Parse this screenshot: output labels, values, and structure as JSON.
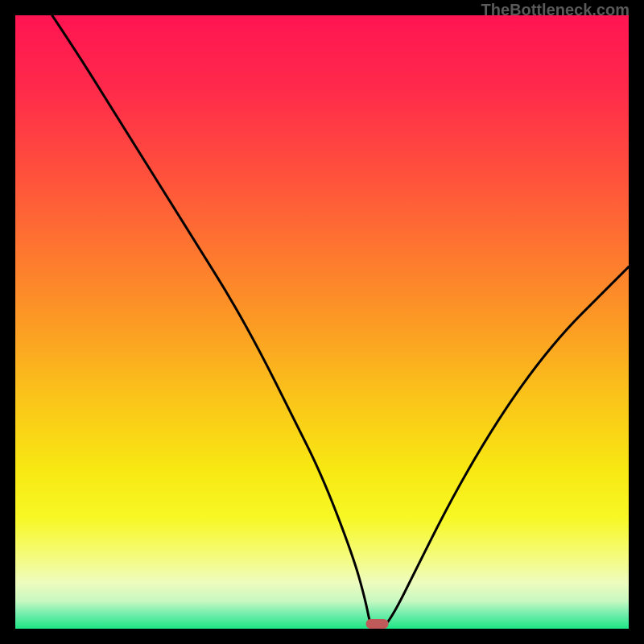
{
  "attribution": "TheBottleneck.com",
  "chart_data": {
    "type": "line",
    "title": "",
    "xlabel": "",
    "ylabel": "",
    "xlim": [
      0,
      100
    ],
    "ylim": [
      0,
      100
    ],
    "grid": false,
    "legend": false,
    "series": [
      {
        "name": "bottleneck-curve",
        "stroke": "#000000",
        "x": [
          6,
          10,
          15,
          20,
          25,
          30,
          35,
          40,
          45,
          50,
          55,
          57,
          58,
          59,
          60,
          62,
          65,
          70,
          75,
          80,
          85,
          90,
          95,
          100
        ],
        "y": [
          100,
          94,
          86,
          78,
          70,
          62,
          54,
          45,
          35,
          25,
          12,
          5,
          0,
          0,
          0,
          3,
          9,
          19,
          28,
          36,
          43,
          49,
          54,
          59
        ]
      }
    ],
    "marker": {
      "name": "min-marker",
      "x": 59,
      "color": "#c05a5a"
    },
    "gradient_stops": [
      {
        "offset": 0.0,
        "color": "#ff1452"
      },
      {
        "offset": 0.12,
        "color": "#ff2a4b"
      },
      {
        "offset": 0.25,
        "color": "#ff4e3d"
      },
      {
        "offset": 0.38,
        "color": "#fe7530"
      },
      {
        "offset": 0.5,
        "color": "#fc9a24"
      },
      {
        "offset": 0.62,
        "color": "#fac31a"
      },
      {
        "offset": 0.74,
        "color": "#f8e812"
      },
      {
        "offset": 0.82,
        "color": "#f7f825"
      },
      {
        "offset": 0.88,
        "color": "#f5fb79"
      },
      {
        "offset": 0.925,
        "color": "#eefcbe"
      },
      {
        "offset": 0.955,
        "color": "#c7f8c1"
      },
      {
        "offset": 0.975,
        "color": "#77eeae"
      },
      {
        "offset": 1.0,
        "color": "#1ee584"
      }
    ]
  }
}
